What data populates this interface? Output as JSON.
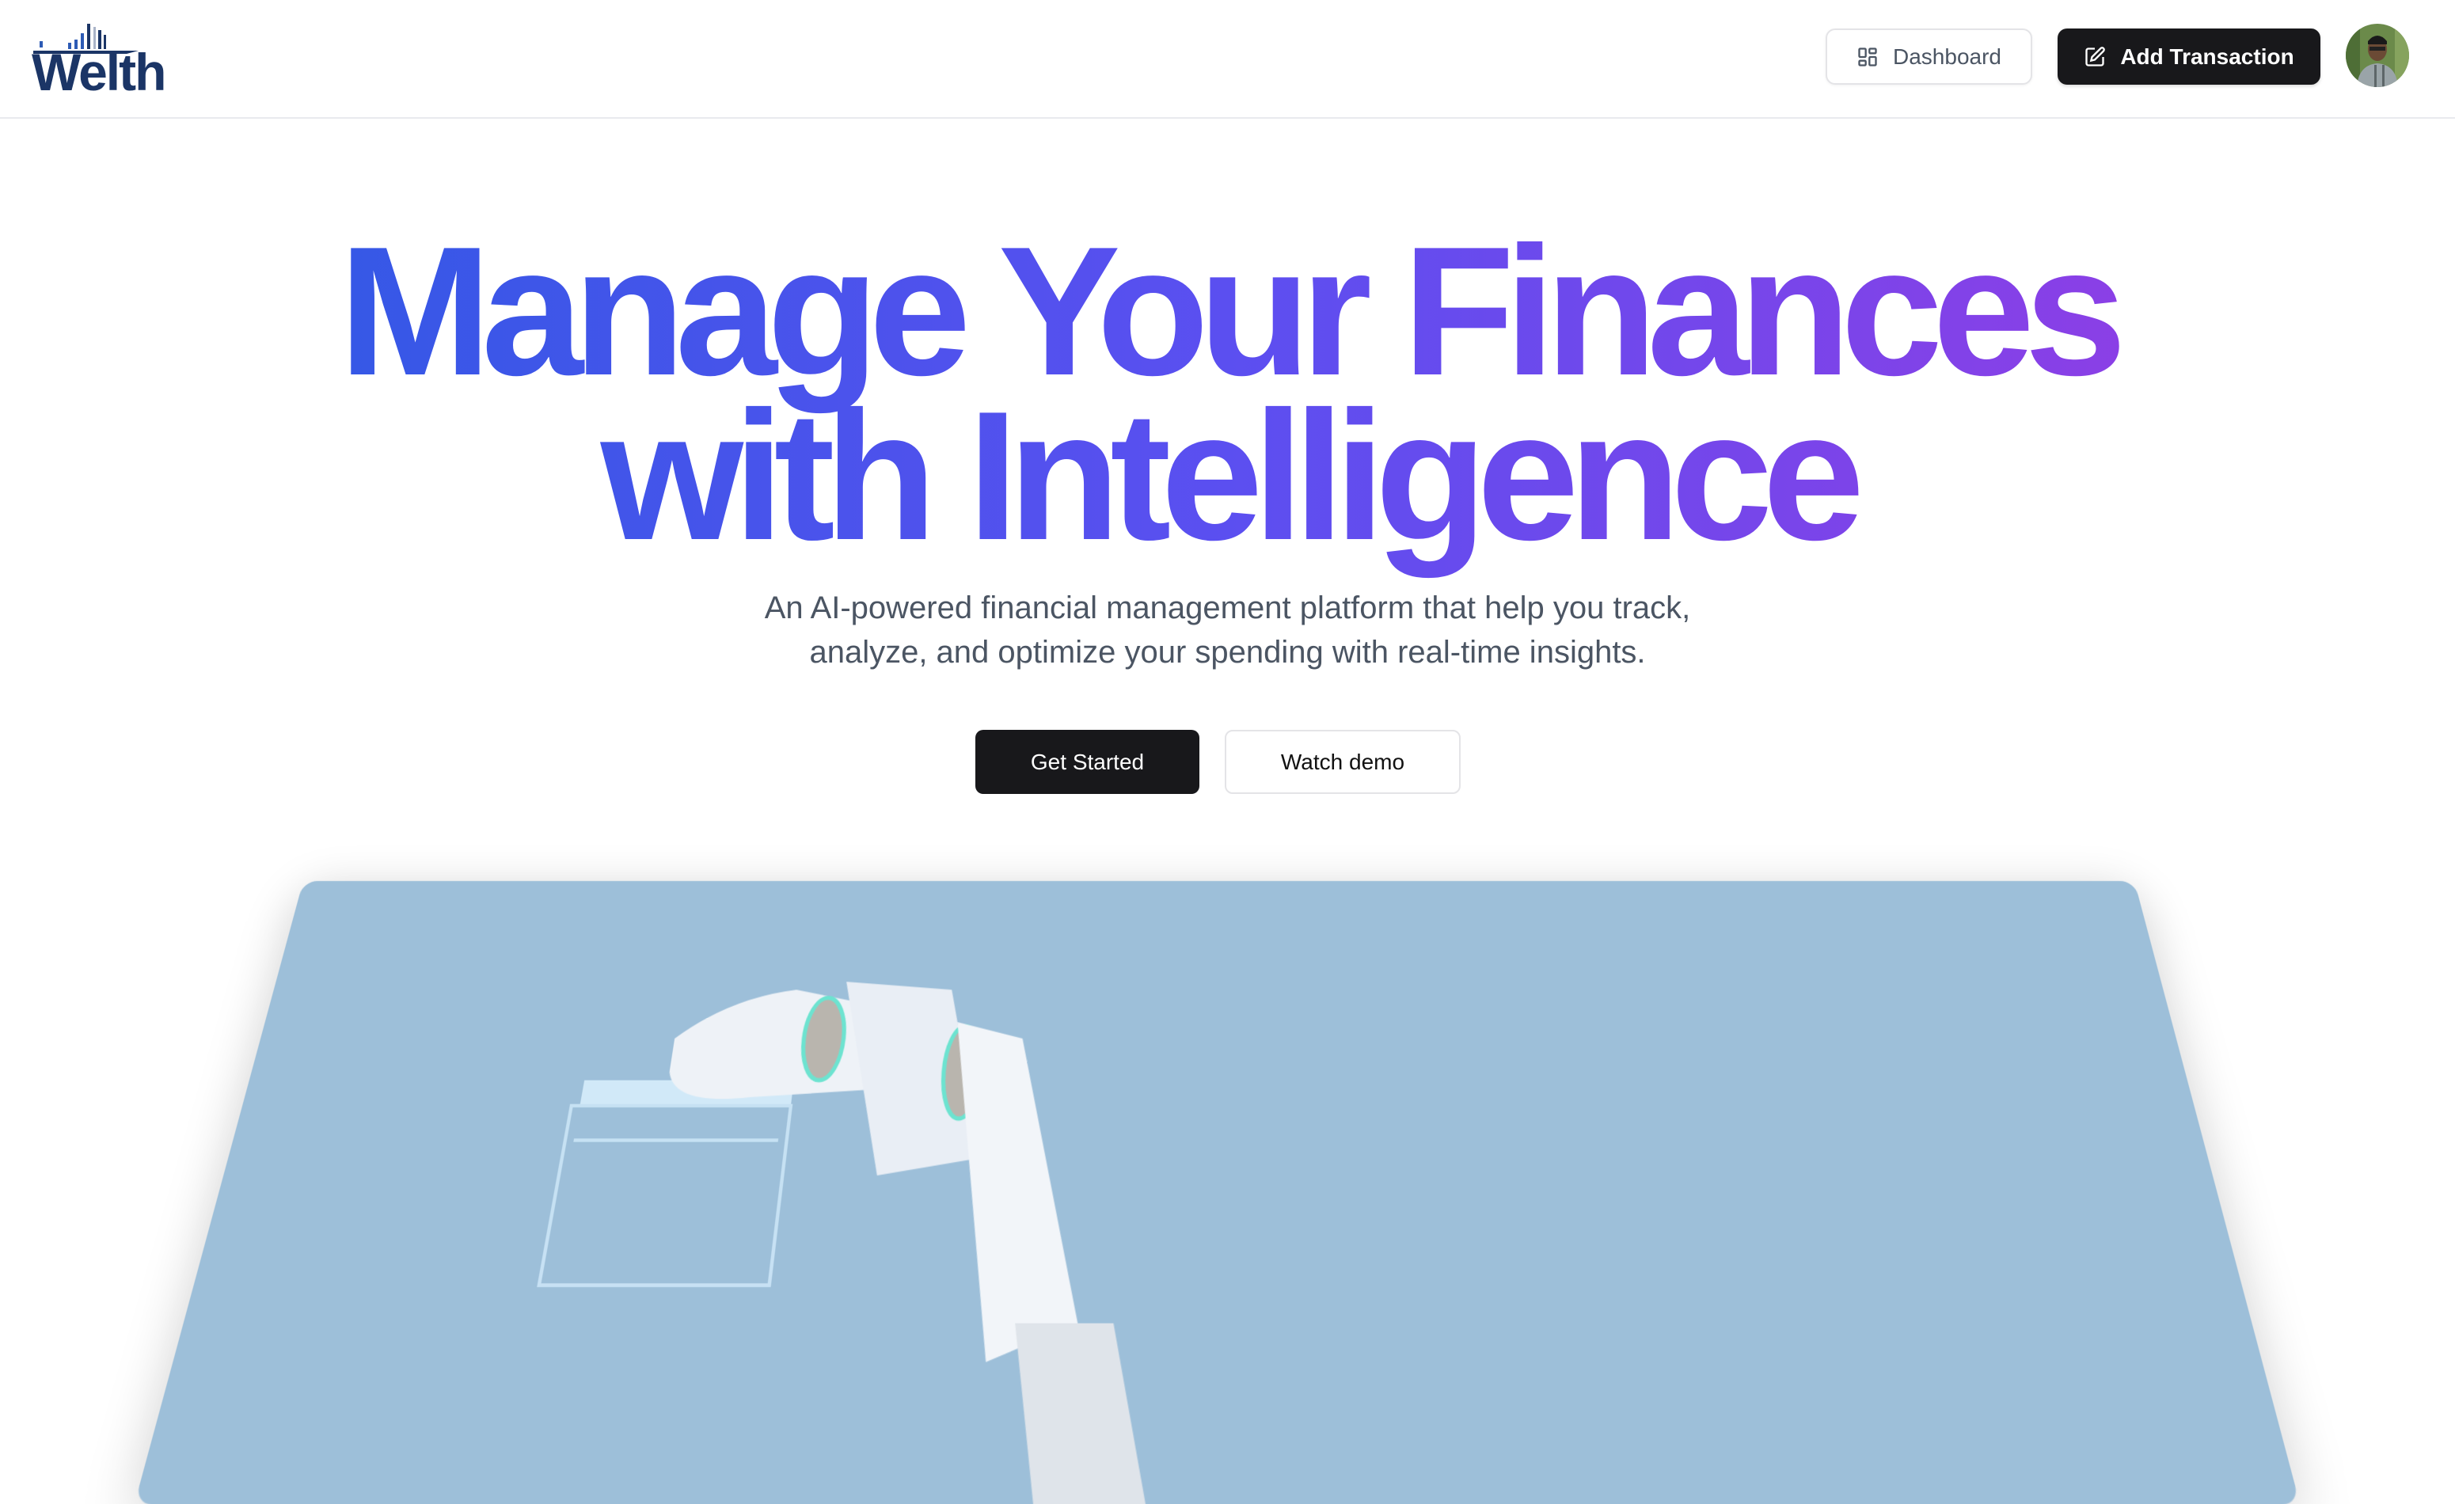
{
  "header": {
    "logo_text": "Welth",
    "dashboard_label": "Dashboard",
    "add_transaction_label": "Add Transaction"
  },
  "hero": {
    "title_line1": "Manage Your Finances",
    "title_line2": "with Intelligence",
    "subtitle_line1": "An AI-powered financial management platform that help you track,",
    "subtitle_line2": "analyze, and optimize your spending with real-time insights.",
    "get_started_label": "Get Started",
    "watch_demo_label": "Watch demo"
  },
  "colors": {
    "gradient_start": "#3558e6",
    "gradient_end": "#8b3fe6",
    "logo": "#1b3566",
    "hero_image_bg": "#9dbfd9"
  }
}
